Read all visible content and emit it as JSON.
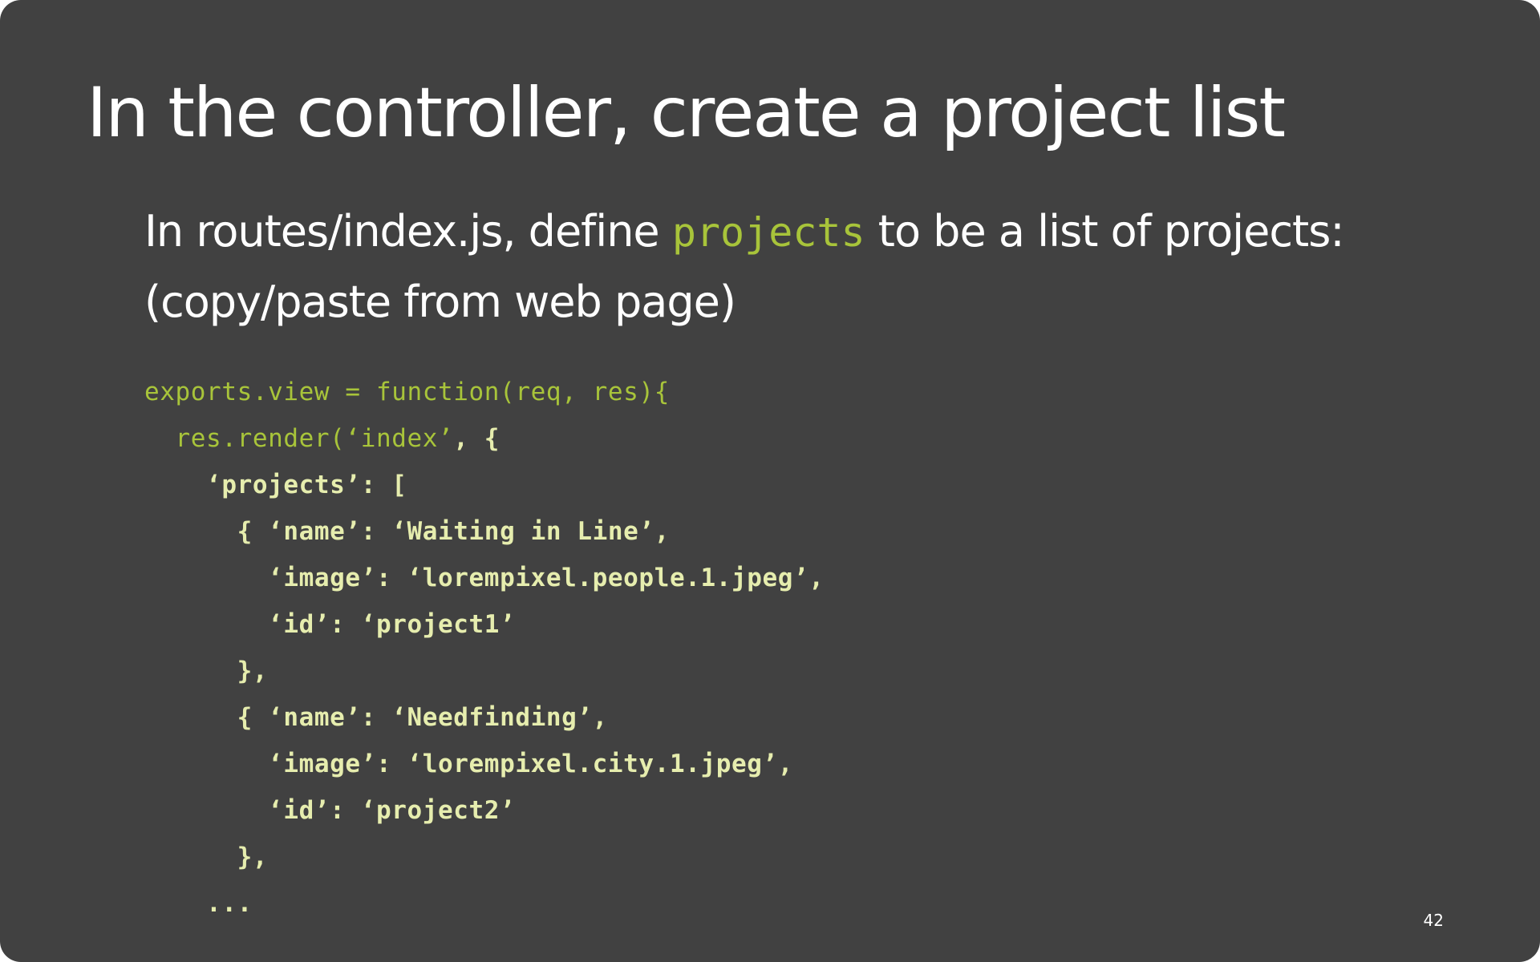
{
  "slide": {
    "title": "In the controller, create a project list",
    "body_line1_before": "In routes/index.js, define ",
    "body_line1_code": "projects",
    "body_line1_after": " to be a list of projects:",
    "body_line2": "(copy/paste from web page)",
    "code_lines": [
      {
        "indent": "",
        "green": "exports.view = function(req, res){",
        "rest": ""
      },
      {
        "indent": "  ",
        "green": "res.render(‘index’",
        "rest": ", {"
      },
      {
        "indent": "    ",
        "green": "",
        "rest": "‘projects’: ["
      },
      {
        "indent": "      ",
        "green": "",
        "rest": "{ ‘name’: ‘Waiting in Line’,"
      },
      {
        "indent": "        ",
        "green": "",
        "rest": "‘image’: ‘lorempixel.people.1.jpeg’,"
      },
      {
        "indent": "        ",
        "green": "",
        "rest": "‘id’: ‘project1’"
      },
      {
        "indent": "      ",
        "green": "",
        "rest": "},"
      },
      {
        "indent": "      ",
        "green": "",
        "rest": "{ ‘name’: ‘Needfinding’,"
      },
      {
        "indent": "        ",
        "green": "",
        "rest": "‘image’: ‘lorempixel.city.1.jpeg’,"
      },
      {
        "indent": "        ",
        "green": "",
        "rest": "‘id’: ‘project2’"
      },
      {
        "indent": "      ",
        "green": "",
        "rest": "},"
      },
      {
        "indent": "    ",
        "green": "",
        "rest": "..."
      }
    ],
    "page_number": "42",
    "colors": {
      "background": "#414141",
      "text": "#ffffff",
      "code_green": "#a8c43a",
      "code_cream": "#e6edae"
    }
  }
}
